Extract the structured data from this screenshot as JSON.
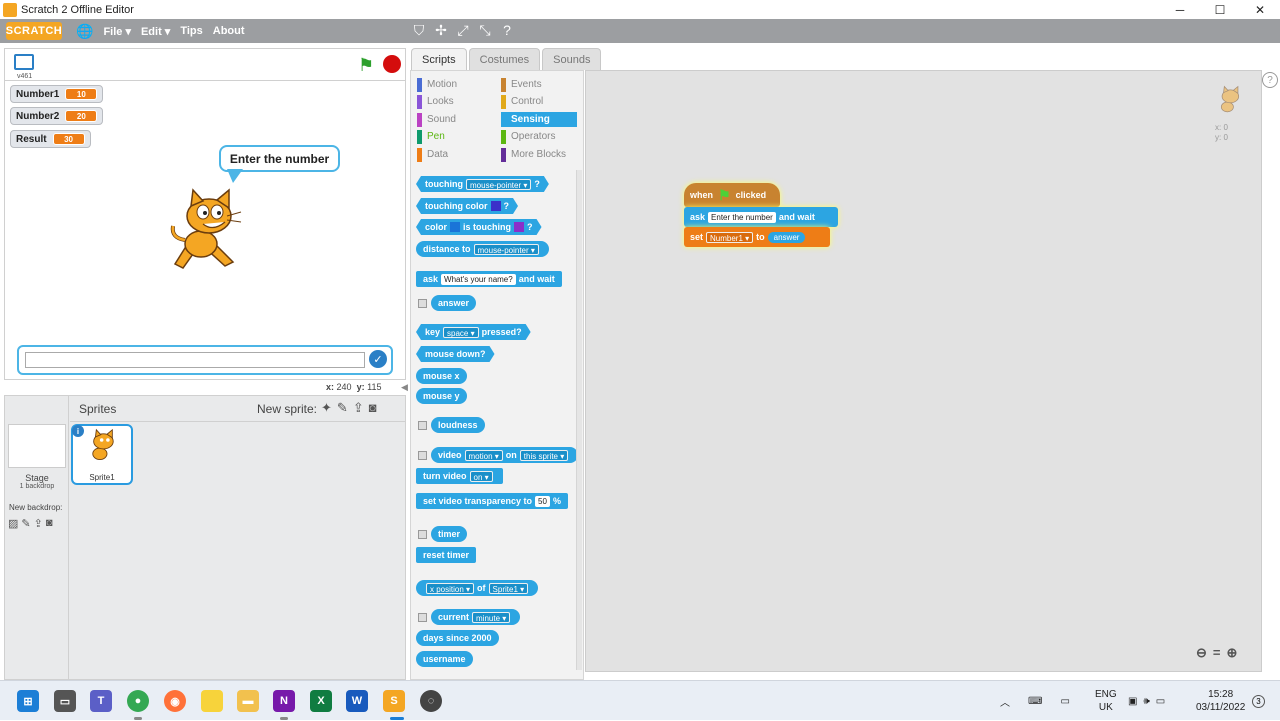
{
  "window": {
    "title": "Scratch 2 Offline Editor",
    "controls": {
      "minimize": "─",
      "maximize": "☐",
      "close": "✕"
    }
  },
  "menubar": {
    "logo": "SCRATCH",
    "items": [
      "File ▾",
      "Edit ▾",
      "Tips",
      "About"
    ]
  },
  "stage": {
    "version": "v461",
    "monitors": [
      {
        "label": "Number1",
        "value": "10"
      },
      {
        "label": "Number2",
        "value": "20"
      },
      {
        "label": "Result",
        "value": "30"
      }
    ],
    "speech": "Enter the number",
    "answer_value": "",
    "coords": {
      "x_label": "x:",
      "x": "240",
      "y_label": "y:",
      "y": "115"
    }
  },
  "sprites_pane": {
    "stage_label": "Stage",
    "stage_sub": "1 backdrop",
    "new_backdrop": "New backdrop:",
    "title": "Sprites",
    "new_sprite": "New sprite:",
    "sprite_info": "i",
    "sprites": [
      "Sprite1"
    ]
  },
  "tabs": [
    "Scripts",
    "Costumes",
    "Sounds"
  ],
  "categories": [
    {
      "label": "Motion",
      "color": "#4a6cd4"
    },
    {
      "label": "Looks",
      "color": "#8a55d7"
    },
    {
      "label": "Sound",
      "color": "#bb42c3"
    },
    {
      "label": "Pen",
      "color": "#0e9a6c"
    },
    {
      "label": "Data",
      "color": "#ee7d16"
    },
    {
      "label": "Events",
      "color": "#c88330"
    },
    {
      "label": "Control",
      "color": "#e1a91a"
    },
    {
      "label": "Sensing",
      "color": "#2ca5e2"
    },
    {
      "label": "Operators",
      "color": "#5cb712"
    },
    {
      "label": "More Blocks",
      "color": "#632d99"
    }
  ],
  "palette": {
    "touching": "touching",
    "mouse_pointer": "mouse-pointer ▾",
    "q": "?",
    "touching_color": "touching color",
    "color": "color",
    "is_touching": "is touching",
    "distance_to": "distance to",
    "ask": "ask",
    "ask_default": "What's your name?",
    "and_wait": "and wait",
    "answer": "answer",
    "key": "key",
    "space": "space ▾",
    "pressed": "pressed?",
    "mouse_down": "mouse down?",
    "mouse_x": "mouse x",
    "mouse_y": "mouse y",
    "loudness": "loudness",
    "video": "video",
    "motion": "motion ▾",
    "on": "on",
    "this_sprite": "this sprite ▾",
    "turn_video": "turn video",
    "on_dd": "on ▾",
    "set_video_transparency": "set video transparency to",
    "transparency_value": "50",
    "pct": "%",
    "timer": "timer",
    "reset_timer": "reset timer",
    "x_position": "x position ▾",
    "of": "of",
    "sprite1_dd": "Sprite1 ▾",
    "current": "current",
    "minute": "minute ▾",
    "days_since": "days since 2000",
    "username": "username"
  },
  "script": {
    "when": "when",
    "clicked": "clicked",
    "ask": "ask",
    "ask_text": "Enter the number",
    "and_wait": "and wait",
    "set": "set",
    "var": "Number1 ▾",
    "to": "to",
    "answer": "answer"
  },
  "script_area": {
    "ghost_x": "x: 0",
    "ghost_y": "y: 0"
  },
  "taskbar": {
    "lang": "ENG",
    "region": "UK",
    "time": "15:28",
    "date": "03/11/2022",
    "notifications": "3"
  },
  "colors": {
    "sensing": "#2ca5e2",
    "events": "#c88330",
    "data": "#ee7d16",
    "menubar": "#9c9ea1"
  }
}
